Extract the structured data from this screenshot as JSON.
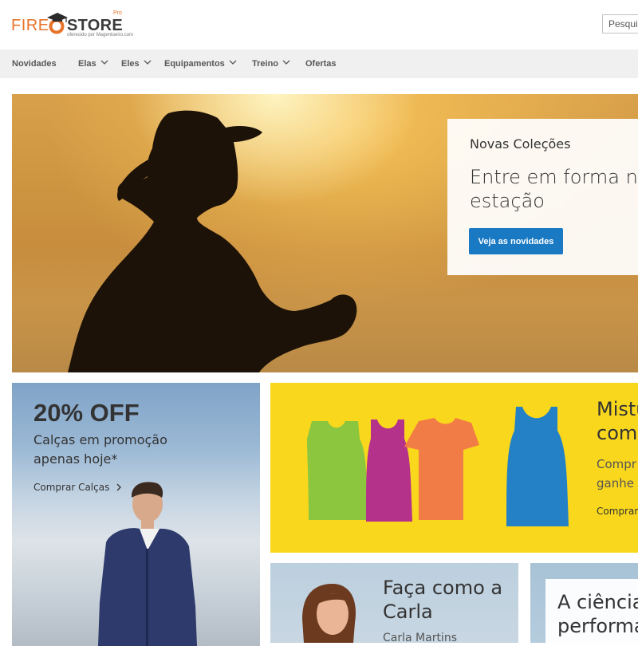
{
  "header": {
    "logo": {
      "part1": "FIRE",
      "part2": "STORE",
      "tagline": "oferecido por Magentoeiro.com",
      "badge": "Pro"
    },
    "search": {
      "placeholder": "Pesquisar"
    }
  },
  "nav": {
    "items": [
      {
        "label": "Novidades",
        "has_dropdown": false
      },
      {
        "label": "Elas",
        "has_dropdown": true
      },
      {
        "label": "Eles",
        "has_dropdown": true
      },
      {
        "label": "Equipamentos",
        "has_dropdown": true
      },
      {
        "label": "Treino",
        "has_dropdown": true
      },
      {
        "label": "Ofertas",
        "has_dropdown": false
      }
    ]
  },
  "hero": {
    "kicker": "Novas Coleções",
    "headline": "Entre em forma no\nestação",
    "cta": "Veja as novidades",
    "colors": {
      "button": "#1979c3"
    }
  },
  "promo_pants": {
    "title": "20% OFF",
    "subtitle": "Calças em promoção\napenas hoje*",
    "link": "Comprar Calças",
    "link_icon": "chevron-right-icon"
  },
  "promo_tees": {
    "title": "Mistu\ncomb",
    "subtitle": "Compr\nganhe",
    "link": "Comprar",
    "background": "#f9d71c",
    "tee_colors": [
      "#8cc63e",
      "#b5328a",
      "#f27c45",
      "#2481c6"
    ]
  },
  "promo_carla": {
    "title": "Faça como a\nCarla",
    "subtitle": "Carla Martins"
  },
  "promo_science": {
    "title": "A ciência\nperforma"
  }
}
